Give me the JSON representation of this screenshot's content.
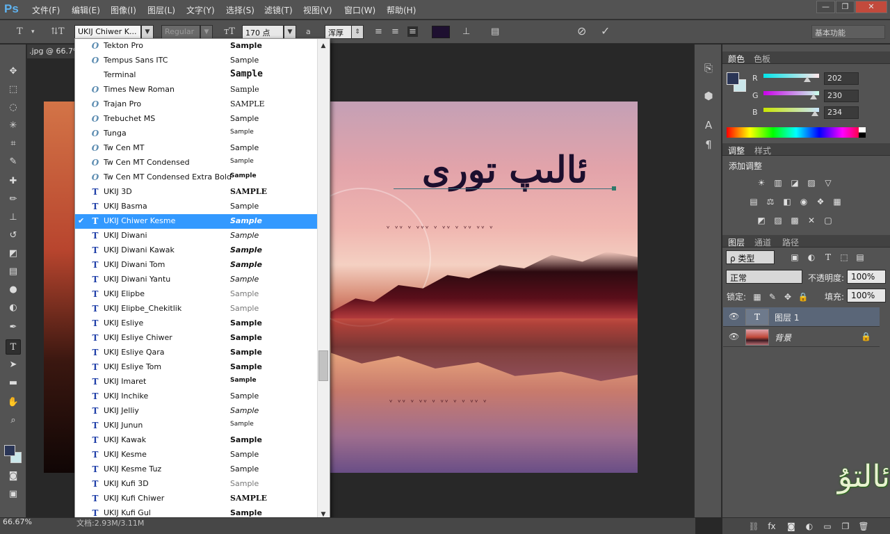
{
  "app": {
    "logo": "Ps"
  },
  "menu": [
    "文件(F)",
    "编辑(E)",
    "图像(I)",
    "图层(L)",
    "文字(Y)",
    "选择(S)",
    "滤镜(T)",
    "视图(V)",
    "窗口(W)",
    "帮助(H)"
  ],
  "options": {
    "font_family": "UKIJ Chiwer K...",
    "font_style": "Regular",
    "font_size": "170 点",
    "aa_label": "a",
    "antialias": "浑厚",
    "workspace": "基本功能",
    "text_color": "#1e1030"
  },
  "document": {
    "tab_title": ".jpg @ 66.7%",
    "canvas_text": "ئالىپ تورى",
    "zoom": "66.67%",
    "doc_size": "文档:2.93M/3.11M"
  },
  "font_list": {
    "selected": "UKIJ Chiwer Kesme",
    "items": [
      {
        "name": "Tekton Pro",
        "type": "otf",
        "sample": "Sample",
        "sample_style": "bold"
      },
      {
        "name": "Tempus Sans ITC",
        "type": "otf",
        "sample": "Sample",
        "sample_style": "normal"
      },
      {
        "name": "Terminal",
        "type": "none",
        "sample": "Sample",
        "sample_style": "mono"
      },
      {
        "name": "Times New Roman",
        "type": "otf",
        "sample": "Sample",
        "sample_style": "serif"
      },
      {
        "name": "Trajan Pro",
        "type": "otf",
        "sample": "SAMPLE",
        "sample_style": "serif"
      },
      {
        "name": "Trebuchet MS",
        "type": "otf",
        "sample": "Sample",
        "sample_style": "normal"
      },
      {
        "name": "Tunga",
        "type": "otf",
        "sample": "Sample",
        "sample_style": "small"
      },
      {
        "name": "Tw Cen MT",
        "type": "otf",
        "sample": "Sample",
        "sample_style": "normal"
      },
      {
        "name": "Tw Cen MT Condensed",
        "type": "otf",
        "sample": "Sample",
        "sample_style": "small"
      },
      {
        "name": "Tw Cen MT Condensed Extra Bold",
        "type": "otf",
        "sample": "Sample",
        "sample_style": "bold-small"
      },
      {
        "name": "UKIJ 3D",
        "type": "tt",
        "sample": "SAMPLE",
        "sample_style": "bold"
      },
      {
        "name": "UKIJ Basma",
        "type": "tt",
        "sample": "Sample",
        "sample_style": "normal"
      },
      {
        "name": "UKIJ Chiwer Kesme",
        "type": "tt",
        "sample": "Sample",
        "sample_style": "italic-bold"
      },
      {
        "name": "UKIJ Diwani",
        "type": "tt",
        "sample": "Sample",
        "sample_style": "italic"
      },
      {
        "name": "UKIJ Diwani Kawak",
        "type": "tt",
        "sample": "Sample",
        "sample_style": "italic-bold"
      },
      {
        "name": "UKIJ Diwani Tom",
        "type": "tt",
        "sample": "Sample",
        "sample_style": "italic-bold"
      },
      {
        "name": "UKIJ Diwani Yantu",
        "type": "tt",
        "sample": "Sample",
        "sample_style": "italic"
      },
      {
        "name": "UKIJ Elipbe",
        "type": "tt",
        "sample": "Sample",
        "sample_style": "light"
      },
      {
        "name": "UKIJ Elipbe_Chekitlik",
        "type": "tt",
        "sample": "Sample",
        "sample_style": "light"
      },
      {
        "name": "UKIJ Esliye",
        "type": "tt",
        "sample": "Sample",
        "sample_style": "bold"
      },
      {
        "name": "UKIJ Esliye Chiwer",
        "type": "tt",
        "sample": "Sample",
        "sample_style": "bold"
      },
      {
        "name": "UKIJ Esliye Qara",
        "type": "tt",
        "sample": "Sample",
        "sample_style": "bold"
      },
      {
        "name": "UKIJ Esliye Tom",
        "type": "tt",
        "sample": "Sample",
        "sample_style": "bold"
      },
      {
        "name": "UKIJ Imaret",
        "type": "tt",
        "sample": "Sample",
        "sample_style": "bold-small"
      },
      {
        "name": "UKIJ Inchike",
        "type": "tt",
        "sample": "Sample",
        "sample_style": "normal"
      },
      {
        "name": "UKIJ Jelliy",
        "type": "tt",
        "sample": "Sample",
        "sample_style": "italic"
      },
      {
        "name": "UKIJ Junun",
        "type": "tt",
        "sample": "Sample",
        "sample_style": "small"
      },
      {
        "name": "UKIJ Kawak",
        "type": "tt",
        "sample": "Sample",
        "sample_style": "bold"
      },
      {
        "name": "UKIJ Kesme",
        "type": "tt",
        "sample": "Sample",
        "sample_style": "normal"
      },
      {
        "name": "UKIJ Kesme Tuz",
        "type": "tt",
        "sample": "Sample",
        "sample_style": "normal"
      },
      {
        "name": "UKIJ Kufi 3D",
        "type": "tt",
        "sample": "Sample",
        "sample_style": "light"
      },
      {
        "name": "UKIJ Kufi Chiwer",
        "type": "tt",
        "sample": "SAMPLE",
        "sample_style": "bold"
      },
      {
        "name": "UKIJ Kufi Gul",
        "type": "tt",
        "sample": "Sample",
        "sample_style": "bold"
      }
    ]
  },
  "panels": {
    "color_tabs": [
      "颜色",
      "色板"
    ],
    "color": {
      "fg": "#2a3556",
      "bg": "#cae6ea",
      "channels": [
        {
          "label": "R",
          "value": "202",
          "fraction": 0.79,
          "gradient": "linear-gradient(90deg,#00e6ea,#ffe6ea)"
        },
        {
          "label": "G",
          "value": "230",
          "fraction": 0.9,
          "gradient": "linear-gradient(90deg,#ca00ea,#caffea)"
        },
        {
          "label": "B",
          "value": "234",
          "fraction": 0.92,
          "gradient": "linear-gradient(90deg,#cae600,#cae6ff)"
        }
      ]
    },
    "adjust_tabs": [
      "调整",
      "样式"
    ],
    "adjust_title": "添加调整",
    "adjust_icons_row1": [
      "☀",
      "▥",
      "◪",
      "▨",
      "▽"
    ],
    "adjust_icons_row2": [
      "▤",
      "⚖",
      "◧",
      "◉",
      "❖",
      "▦"
    ],
    "adjust_icons_row3": [
      "◩",
      "▨",
      "▩",
      "✕",
      "▢"
    ],
    "layer_tabs": [
      "图层",
      "通道",
      "路径"
    ],
    "layers": {
      "filter_label": "ρ 类型",
      "blend_mode": "正常",
      "opacity_label": "不透明度:",
      "opacity": "100%",
      "lock_label": "锁定:",
      "fill_label": "填充:",
      "fill": "100%",
      "items": [
        {
          "name": "图层 1",
          "kind": "text",
          "thumb": "T"
        },
        {
          "name": "背景",
          "kind": "image",
          "thumb": ""
        }
      ]
    }
  },
  "icons": {
    "toolbar": [
      "move-icon",
      "marquee-icon",
      "lasso-icon",
      "magic-wand-icon",
      "crop-icon",
      "eyedropper-icon",
      "healing-brush-icon",
      "brush-icon",
      "clone-stamp-icon",
      "history-brush-icon",
      "eraser-icon",
      "gradient-icon",
      "blur-icon",
      "dodge-icon",
      "pen-icon",
      "type-icon",
      "path-selection-icon",
      "rectangle-icon",
      "hand-icon",
      "zoom-icon"
    ]
  }
}
